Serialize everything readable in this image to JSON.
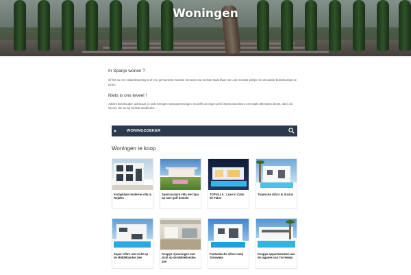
{
  "hero": {
    "title": "Woningen"
  },
  "intro": {
    "question": "In Spanje wonen ?",
    "paragraph1": "Of het nu een vakantiewoning is of een permanente woonst, het team van Gelmar staat klaar om u de mooiste plekjes en de laatste buitenkansjes te tonen.",
    "heading2": "Niets is ons teveel !",
    "paragraph2": "Advies boekhouder, advocaat, in orde brengen nutsvoorzieningen, tot zelfs uw eigen privé interieurarchitect, een totale aftersales dienst, dat is de service die we bij Gelmar aanbieden."
  },
  "finder": {
    "label": "WONINGZOEKER",
    "icon": "search-icon",
    "toggle_icon": "caret-right-icon",
    "bar_color": "#2a3a4c"
  },
  "listings": {
    "title": "Woningen te koop",
    "items": [
      {
        "title": "Instapklare moderne villa in Rojales"
      },
      {
        "title": "Spectaculaire villa met Spa op luxe golf domein"
      },
      {
        "title": "TOPVILLA : Luxe in Cabo de Palos"
      },
      {
        "title": "Tropische villa's in Sucina"
      },
      {
        "title": "Super villa's met zicht op de Middellandse Zee"
      },
      {
        "title": "Knappe rijwoningen met zicht op de Middellandse Zee"
      },
      {
        "title": "Fantastische villa's nabij Torrevieja"
      },
      {
        "title": "Knappe appartementen aan de lagunes van Torrevieja"
      }
    ]
  }
}
